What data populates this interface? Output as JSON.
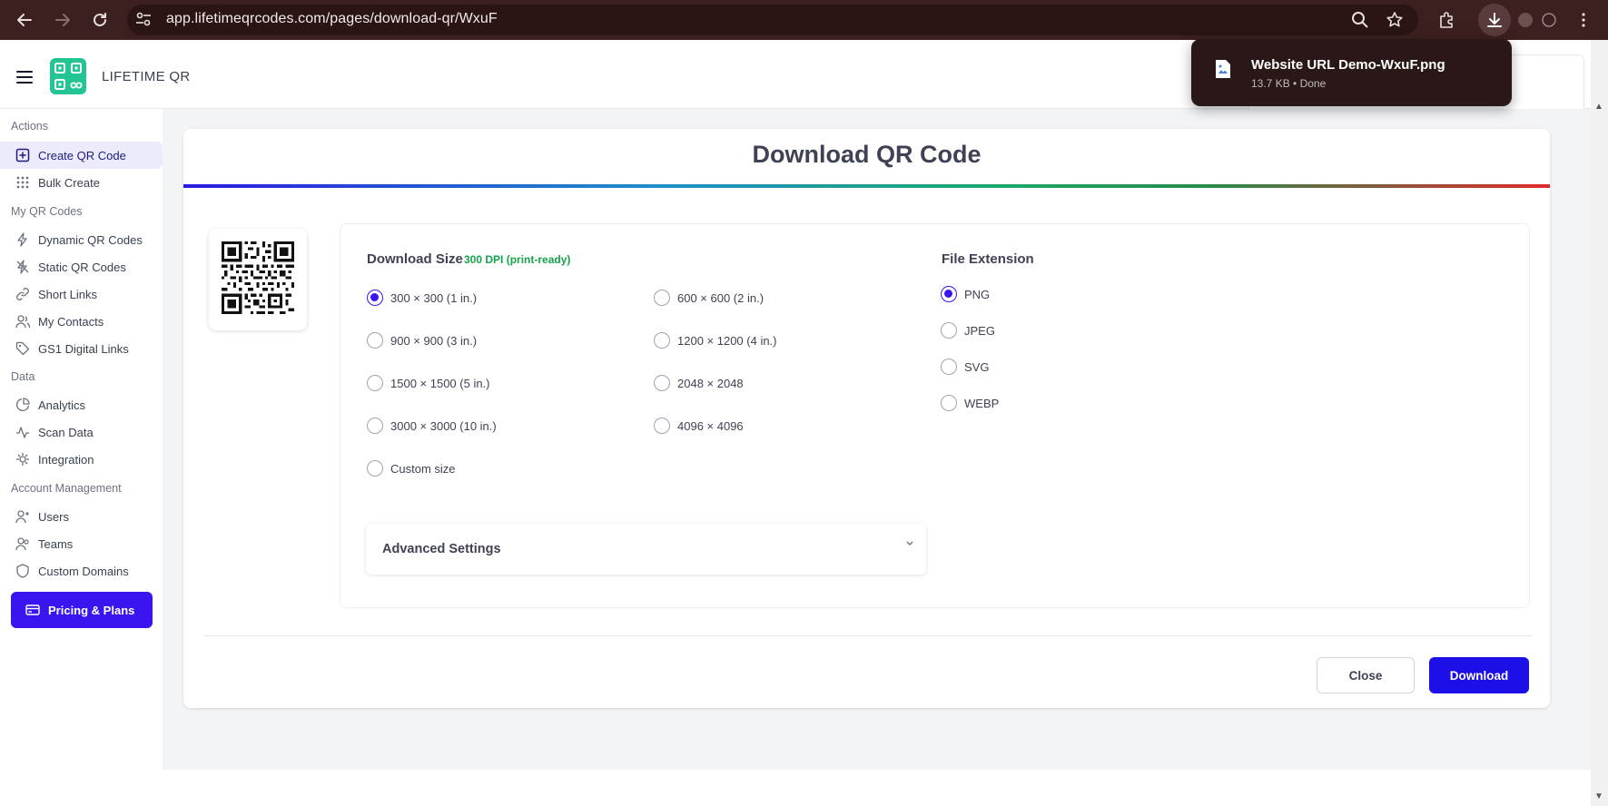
{
  "browser": {
    "url": "app.lifetimeqrcodes.com/pages/download-qr/WxuF"
  },
  "download_popup": {
    "file_name": "Website URL Demo-WxuF.png",
    "meta": "13.7 KB • Done"
  },
  "header": {
    "brand": "LIFETIME QR"
  },
  "sidebar": {
    "sections": {
      "actions": "Actions",
      "my_qr_codes": "My QR Codes",
      "data": "Data",
      "account": "Account Management"
    },
    "items": [
      {
        "label": "Create QR Code",
        "icon": "plus-square-icon"
      },
      {
        "label": "Bulk Create",
        "icon": "grid-dots-icon"
      },
      {
        "label": "Dynamic QR Codes",
        "icon": "lightning-icon"
      },
      {
        "label": "Static QR Codes",
        "icon": "lightning-off-icon"
      },
      {
        "label": "Short Links",
        "icon": "link-icon"
      },
      {
        "label": "My Contacts",
        "icon": "users-icon"
      },
      {
        "label": "GS1 Digital Links",
        "icon": "tag-icon"
      },
      {
        "label": "Analytics",
        "icon": "pie-chart-icon"
      },
      {
        "label": "Scan Data",
        "icon": "activity-icon"
      },
      {
        "label": "Integration",
        "icon": "plug-icon"
      },
      {
        "label": "Users",
        "icon": "user-plus-icon"
      },
      {
        "label": "Teams",
        "icon": "team-icon"
      },
      {
        "label": "Custom Domains",
        "icon": "shield-icon"
      }
    ],
    "pricing_label": "Pricing & Plans"
  },
  "modal": {
    "title": "Download QR Code",
    "download_size_label": "Download Size",
    "dpi_note": "300 DPI (print-ready)",
    "sizes": [
      {
        "label": "300 × 300 (1 in.)",
        "checked": true
      },
      {
        "label": "600 × 600 (2 in.)",
        "checked": false
      },
      {
        "label": "900 × 900 (3 in.)",
        "checked": false
      },
      {
        "label": "1200 × 1200 (4 in.)",
        "checked": false
      },
      {
        "label": "1500 × 1500 (5 in.)",
        "checked": false
      },
      {
        "label": "2048 × 2048",
        "checked": false
      },
      {
        "label": "3000 × 3000 (10 in.)",
        "checked": false
      },
      {
        "label": "4096 × 4096",
        "checked": false
      },
      {
        "label": "Custom size",
        "checked": false
      }
    ],
    "file_extension_label": "File Extension",
    "extensions": [
      {
        "label": "PNG",
        "checked": true
      },
      {
        "label": "JPEG",
        "checked": false
      },
      {
        "label": "SVG",
        "checked": false
      },
      {
        "label": "WEBP",
        "checked": false
      }
    ],
    "advanced_label": "Advanced Settings",
    "close_label": "Close",
    "download_label": "Download"
  },
  "colors": {
    "accent": "#3b14f0",
    "download_button": "#1d0fe8",
    "logo": "#22c593",
    "dpi_note": "#16a34a",
    "browser_bar": "#3c1f1f"
  }
}
